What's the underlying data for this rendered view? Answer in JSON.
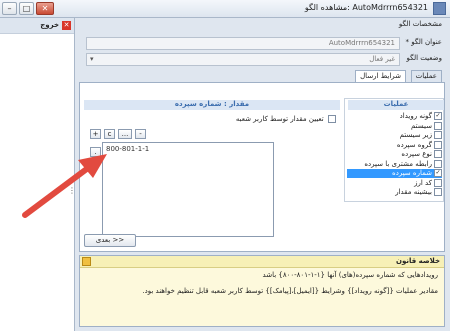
{
  "window": {
    "title": "AutoMdrrrn654321 :مشاهده الگو",
    "min_symbol": "–",
    "max_symbol": "□",
    "close_symbol": "✕"
  },
  "left_panel": {
    "exit_label": "خروج",
    "exit_icon": "✕",
    "handle": "⋮"
  },
  "pattern": {
    "section_title": "مشخصات الگو",
    "name_label": "عنوان الگو *",
    "name_value": "AutoMdrrrn654321",
    "status_label": "وضعیت الگو",
    "status_value": "غیر فعال"
  },
  "tabs": [
    {
      "label": "عملیات"
    },
    {
      "label": "شرایط ارسال"
    }
  ],
  "operations": {
    "header": "عملیات",
    "items": [
      {
        "label": "گونه رویداد",
        "checked": true
      },
      {
        "label": "سیستم",
        "checked": false
      },
      {
        "label": "زیر سیستم",
        "checked": false
      },
      {
        "label": "گروه سپرده",
        "checked": false
      },
      {
        "label": "نوع سپرده",
        "checked": false
      },
      {
        "label": "رابطه مشتری با سپرده",
        "checked": false
      },
      {
        "label": "شماره سپرده",
        "checked": true,
        "selected": true
      },
      {
        "label": "کد ارز",
        "checked": false
      },
      {
        "label": "بیشینه مقدار",
        "checked": false
      }
    ]
  },
  "value_panel": {
    "header": "مقدار : شماره سپرده",
    "branch_option": "تعیین مقدار توسط کاربر شعبه",
    "value_text": "800-801-1-1",
    "btn_add": "+",
    "btn_c": "c",
    "btn_more": "...",
    "btn_remove": "-",
    "btn_dot": "."
  },
  "next_button": "بعدی >>",
  "summary": {
    "title": "خلاصه قانون",
    "line1": "رویدادهایی که شماره سپرده(های) آنها {۱-۱-۸۰۱-۸۰۰} باشد",
    "line2": "مقادیر عملیات {[گونه رویداد]} وشرایط {[ایمیل]،[پیامک]} توسط کاربر شعبه قابل تنظیم خواهند بود."
  },
  "colors": {
    "accent": "#3399ff",
    "arrow": "#e24a3f",
    "summary_bg": "#fdf9dc"
  }
}
